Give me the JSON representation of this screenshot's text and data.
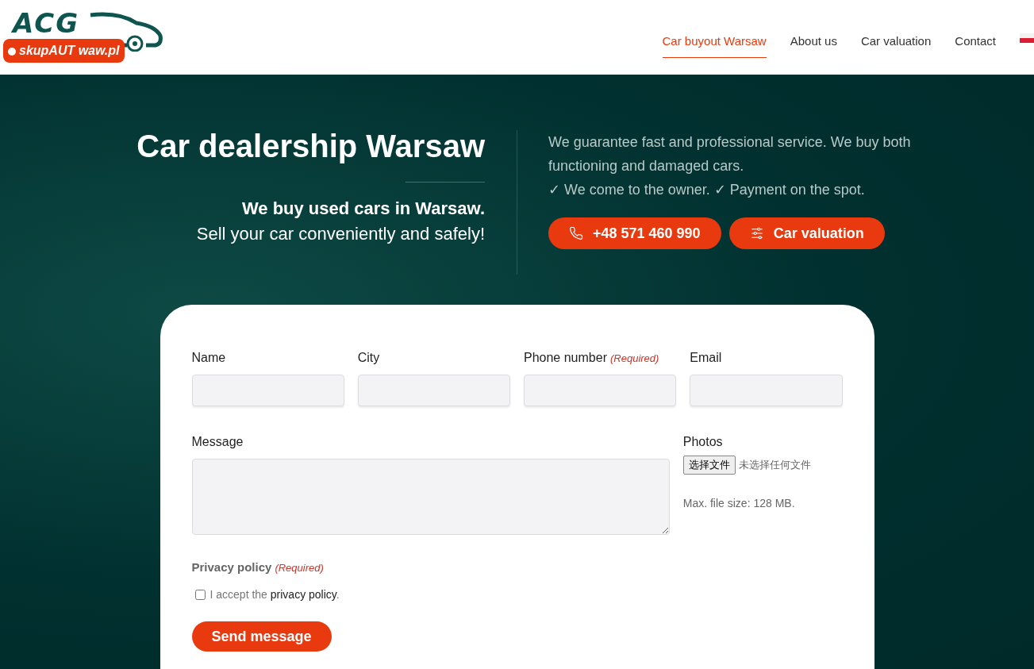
{
  "logo": {
    "brand": "ACG",
    "tag": "skupAUT waw.pl"
  },
  "nav": [
    {
      "label": "Car buyout Warsaw",
      "selected": true
    },
    {
      "label": "About us",
      "selected": false
    },
    {
      "label": "Car valuation",
      "selected": false
    },
    {
      "label": "Contact",
      "selected": false
    }
  ],
  "hero": {
    "title": "Car dealership Warsaw",
    "subtitle": "We buy used cars in Warsaw.",
    "tagline": "Sell your car conveniently and safely!",
    "description": "We guarantee fast and professional service. We buy both functioning and damaged cars.",
    "benefits": "✓ We come to the owner. ✓ Payment on the spot.",
    "buttons": [
      {
        "kind": "phone",
        "label": "+48 571 460 990"
      },
      {
        "kind": "valuation",
        "label": "Car valuation"
      }
    ]
  },
  "form": {
    "fields": [
      {
        "label": "Name"
      },
      {
        "label": "City"
      },
      {
        "label": "Phone number",
        "note": "(Required)"
      },
      {
        "label": "Email"
      }
    ],
    "message_label": "Message",
    "photos": {
      "label": "Photos",
      "button": "选择文件",
      "status": "未选择任何文件",
      "note": "Max. file size: 128 MB."
    },
    "privacy": {
      "label": "Privacy policy",
      "note": "(Required)",
      "prefix": "I accept the ",
      "link": "privacy policy",
      "suffix": ".",
      "checked": false
    },
    "submit": "Send message"
  }
}
